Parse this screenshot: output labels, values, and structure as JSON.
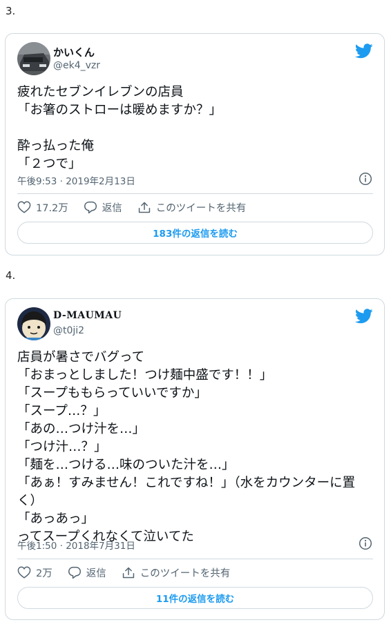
{
  "colors": {
    "accent": "#1d9bf0",
    "text_primary": "#0f1419",
    "text_secondary": "#536471",
    "border": "#cfd9de"
  },
  "sections": [
    {
      "number": "3.",
      "tweet": {
        "author_name": "かいくん",
        "author_handle": "@ek4_vzr",
        "text": "疲れたセブンイレブンの店員\n「お箸のストローは暖めますか？」\n\n酔っ払った俺\n「２つで」",
        "timestamp": "午後9:53 · 2019年2月13日",
        "like_count": "17.2万",
        "reply_label": "返信",
        "share_label": "このツイートを共有",
        "read_replies_label": "183件の返信を読む",
        "icons": {
          "brand": "twitter-bird-icon",
          "info": "info-icon",
          "like": "heart-icon",
          "reply": "reply-bubble-icon",
          "share": "share-icon"
        }
      }
    },
    {
      "number": "4.",
      "tweet": {
        "author_name": "D-MAUMAU",
        "author_handle": "@t0ji2",
        "text": "店員が暑さでバグって\n「おまっとしました！つけ麺中盛です！！」\n「スープももらっていいですか」\n「スープ…？」\n「あの…つけ汁を…」\n「つけ汁…？」\n「麺を…つける…味のついた汁を…」\n「あぁ！すみません！これですね！」（水をカウンターに置く）\n「あっあっ」\nってスープくれなくて泣いてた",
        "timestamp": "午後1:50 · 2018年7月31日",
        "like_count": "2万",
        "reply_label": "返信",
        "share_label": "このツイートを共有",
        "read_replies_label": "11件の返信を読む",
        "icons": {
          "brand": "twitter-bird-icon",
          "info": "info-icon",
          "like": "heart-icon",
          "reply": "reply-bubble-icon",
          "share": "share-icon"
        }
      }
    }
  ]
}
